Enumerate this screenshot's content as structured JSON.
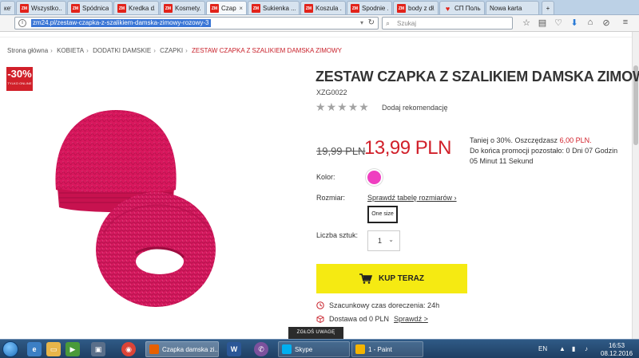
{
  "browser": {
    "tabs": [
      {
        "title": "кеты ...",
        "icon": "generic"
      },
      {
        "title": "Wszystko...",
        "icon": "zm"
      },
      {
        "title": "Spódnica...",
        "icon": "zm"
      },
      {
        "title": "Kredka d...",
        "icon": "zm"
      },
      {
        "title": "Kosmety...",
        "icon": "zm"
      },
      {
        "title": "Czapk...",
        "icon": "zm",
        "active": true
      },
      {
        "title": "Sukienka ...",
        "icon": "zm"
      },
      {
        "title": "Koszula ...",
        "icon": "zm"
      },
      {
        "title": "Spodnie ...",
        "icon": "zm"
      },
      {
        "title": "body z dł...",
        "icon": "zm"
      },
      {
        "title": "СП Польс...",
        "icon": "lips"
      },
      {
        "title": "Nowa karta",
        "icon": "none"
      }
    ],
    "favicon_text": "ZM",
    "url": "zm24.pl/zestaw-czapka-z-szalikiem-damska-zimowy-rozowy-3",
    "search_placeholder": "Szukaj"
  },
  "breadcrumb": [
    "Strona główna",
    "KOBIETA",
    "DODATKI DAMSKIE",
    "CZAPKI",
    "ZESTAW CZAPKA Z SZALIKIEM DAMSKA ZIMOWY"
  ],
  "badge": {
    "percent": "-30%",
    "note": "TYLKO ONLINE"
  },
  "product": {
    "title": "ZESTAW CZAPKA Z SZALIKIEM DAMSKA ZIMOWY",
    "sku": "XZG0022",
    "rating_stars": 5,
    "rating_filled": 0,
    "add_review": "Dodaj rekomendację",
    "old_price": "19,99 PLN",
    "new_price": "13,99 PLN",
    "promo_line1_prefix": "Taniej o 30%. Oszczędzasz",
    "promo_savings": "6,00 PLN.",
    "promo_line2": "Do końca promocji pozostało: 0 Dni 07 Godzin",
    "promo_line3": "05 Minut 11 Sekund",
    "color_label": "Kolor:",
    "color_hex": "#ef3fc0",
    "size_label": "Rozmiar:",
    "size_chart_link": "Sprawdź tabelę rozmiarów ›",
    "size_option": "One size",
    "qty_label": "Liczba sztuk:",
    "qty_value": "1",
    "buy_label": "KUP TERAZ",
    "delivery_time": "Szacunkowy czas doreczenia: 24h",
    "delivery_cost_prefix": "Dostawa od 0 PLN",
    "delivery_cost_link": "Sprawdź >",
    "product_color_hex": "#d8175d"
  },
  "feedback": "ZGŁOŚ UWAGĘ",
  "taskbar": {
    "tasks": [
      {
        "label": "Czapka damska zi...",
        "color": "#e66000",
        "active": true
      },
      {
        "label": "",
        "color": "#2b5797"
      },
      {
        "label": "",
        "color": "#7b519d"
      },
      {
        "label": "Skype",
        "color": "#00aff0"
      },
      {
        "label": "1 - Paint",
        "color": "#f4b400"
      }
    ],
    "lang": "EN",
    "time": "16:53",
    "date": "08.12.2016"
  }
}
